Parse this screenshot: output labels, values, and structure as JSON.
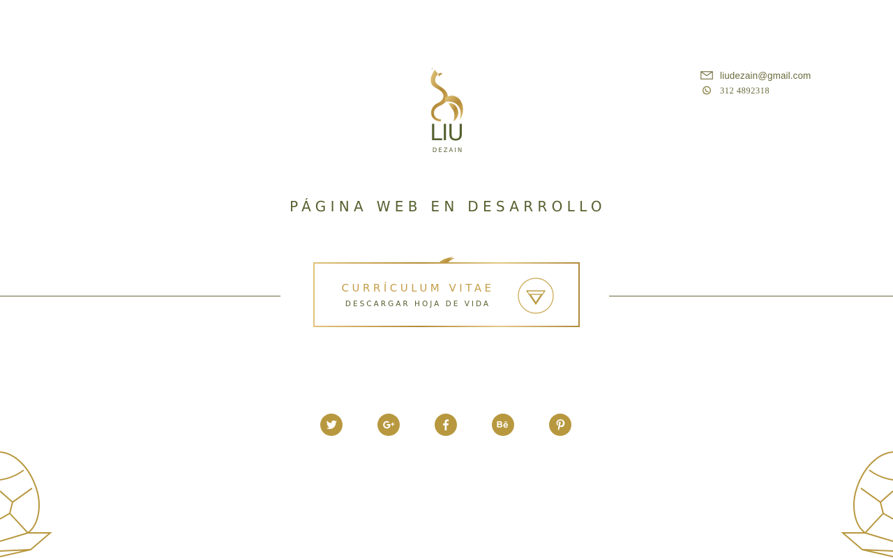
{
  "brand": {
    "name": "LIU",
    "tagline": "DEZAIN"
  },
  "contact": {
    "email": "liudezain@gmail.com",
    "phone": "312 4892318",
    "email_icon": "mail-icon",
    "phone_icon": "whatsapp-icon"
  },
  "headline": "PÁGINA WEB EN DESARROLLO",
  "cv_button": {
    "title": "CURRÍCULUM VITAE",
    "subtitle": "DESCARGAR HOJA DE VIDA",
    "icon": "download-triangle-icon"
  },
  "social": [
    {
      "name": "twitter",
      "icon": "twitter-icon"
    },
    {
      "name": "google-plus",
      "icon": "google-plus-icon"
    },
    {
      "name": "facebook",
      "icon": "facebook-icon"
    },
    {
      "name": "behance",
      "icon": "behance-icon"
    },
    {
      "name": "pinterest",
      "icon": "pinterest-icon"
    }
  ],
  "colors": {
    "gold": "#b8983f",
    "olive": "#56602f",
    "line": "#6b6438",
    "background": "#ffffff"
  }
}
